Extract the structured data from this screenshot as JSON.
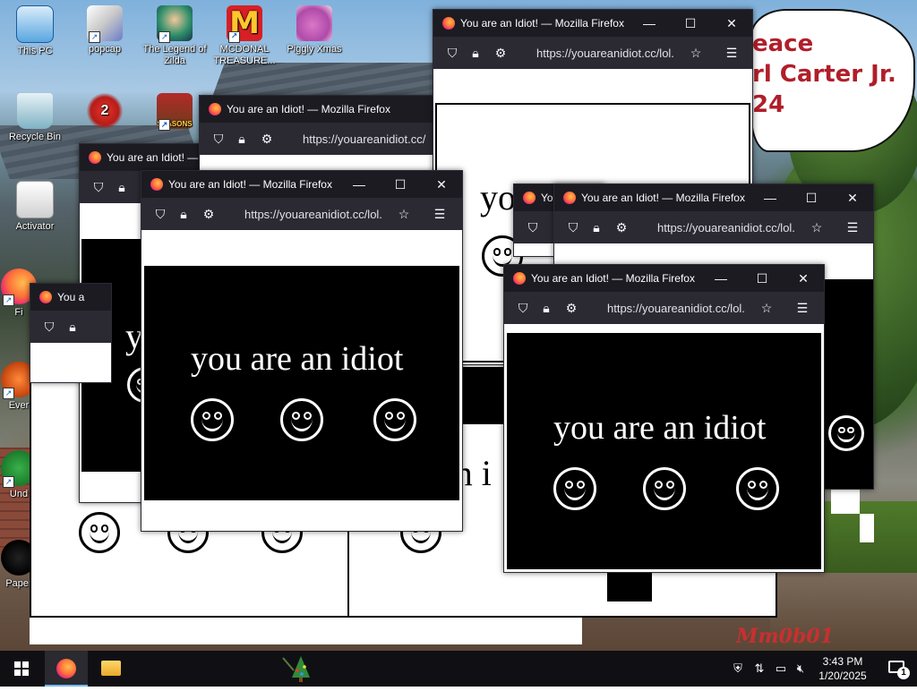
{
  "desktop_icons": [
    {
      "label": "This PC",
      "icon": "computer-icon"
    },
    {
      "label": "popcap",
      "icon": "folder-icon"
    },
    {
      "label": "The Legend of Zilda",
      "icon": "game-icon"
    },
    {
      "label": "MCDONAL TREASURE...",
      "icon": "mcdonalds-icon"
    },
    {
      "label": "Piggly Xmas",
      "icon": "piggy-icon"
    },
    {
      "label": "Recycle Bin",
      "icon": "recycle-bin-icon"
    },
    {
      "label": "",
      "icon": "bird-game-icon",
      "badge": "2"
    },
    {
      "label": "",
      "icon": "angry-birds-icon",
      "caption": "SEASONS"
    },
    {
      "label": "Activator",
      "icon": "activator-icon"
    },
    {
      "label": "Fi",
      "icon": "firefox-icon"
    },
    {
      "label": "Ever",
      "icon": "app-icon"
    },
    {
      "label": "Und",
      "icon": "app-icon"
    },
    {
      "label": "Paper",
      "icon": "app-icon"
    }
  ],
  "banner": {
    "lines": [
      "eace",
      "rl Carter Jr.",
      "24"
    ],
    "bottom_text": "Mm0b01"
  },
  "windows": [
    {
      "id": "w1",
      "title": "You are an Idiot! — Mozilla Firefox",
      "url": "https://youareanidiot.cc/lol.",
      "text": "you are an idiot"
    },
    {
      "id": "w2",
      "title": "You are an Idiot! — Mozilla Firefox",
      "url": "https://youareanidiot.cc/",
      "text": "y"
    },
    {
      "id": "w3",
      "title": "You are an Idiot! — Mozilla Firefox",
      "url": "",
      "text": "y"
    },
    {
      "id": "w4",
      "title": "You a",
      "url": "",
      "text": "y"
    },
    {
      "id": "w5",
      "title": "You are an Idiot! — Mozilla Firefox",
      "url": "https://youareanidiot.cc/lol.",
      "text": "you are an idiot"
    },
    {
      "id": "w6",
      "title": "Yo",
      "url": "",
      "text": ""
    },
    {
      "id": "w7",
      "title": "You are an Idiot! — Mozilla Firefox",
      "url": "https://youareanidiot.cc/lol.",
      "text": "you are an idiot"
    },
    {
      "id": "w8",
      "title": "You are an Idiot! — Mozilla Firefox",
      "url": "https://youareanidiot.cc/lol.",
      "text": "you are an idiot"
    }
  ],
  "background_fragments": {
    "partial_text_1": "yo",
    "partial_text_2": "an i",
    "partial_text_3": "yo"
  },
  "taskbar": {
    "time": "3:43 PM",
    "date": "1/20/2025",
    "notification_count": "1",
    "pinned": [
      "start-button",
      "firefox-icon",
      "file-explorer-icon",
      "christmas-tree-icon"
    ],
    "tray": [
      "security-icon",
      "network-activity-icon",
      "network-icon",
      "volume-muted-icon"
    ]
  },
  "colors": {
    "titlebar": "#1c1b22",
    "toolbar": "#2b2a33",
    "taskbar": "#101014",
    "banner_text": "#b01e2a"
  }
}
